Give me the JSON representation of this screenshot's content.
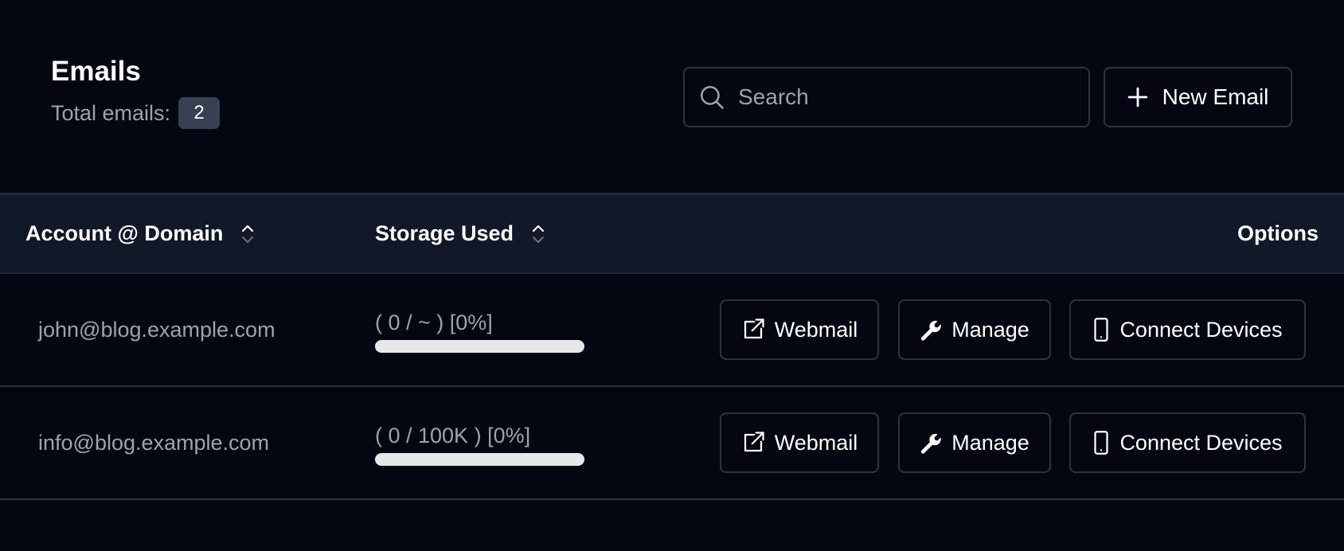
{
  "header": {
    "title": "Emails",
    "total_label": "Total emails:",
    "total_count": "2",
    "search_placeholder": "Search",
    "new_email_label": "New Email"
  },
  "table": {
    "columns": {
      "account": "Account @ Domain",
      "storage": "Storage Used",
      "options": "Options"
    },
    "rows": [
      {
        "email": "john@blog.example.com",
        "storage": "( 0 / ~ ) [0%]",
        "storage_percent": 0,
        "webmail": "Webmail",
        "manage": "Manage",
        "connect": "Connect Devices"
      },
      {
        "email": "info@blog.example.com",
        "storage": "( 0 / 100K ) [0%]",
        "storage_percent": 0,
        "webmail": "Webmail",
        "manage": "Manage",
        "connect": "Connect Devices"
      }
    ]
  },
  "icons": {
    "search": "search-icon",
    "plus": "plus-icon",
    "sort": "sort-icon",
    "webmail": "external-link-icon",
    "manage": "wrench-icon",
    "connect": "mobile-phone-icon"
  },
  "colors": {
    "background": "#030712",
    "header_row": "#111827",
    "border": "#2b3441",
    "muted_text": "#9ca3af",
    "badge": "#374151",
    "progress_track": "#e5e7eb"
  }
}
